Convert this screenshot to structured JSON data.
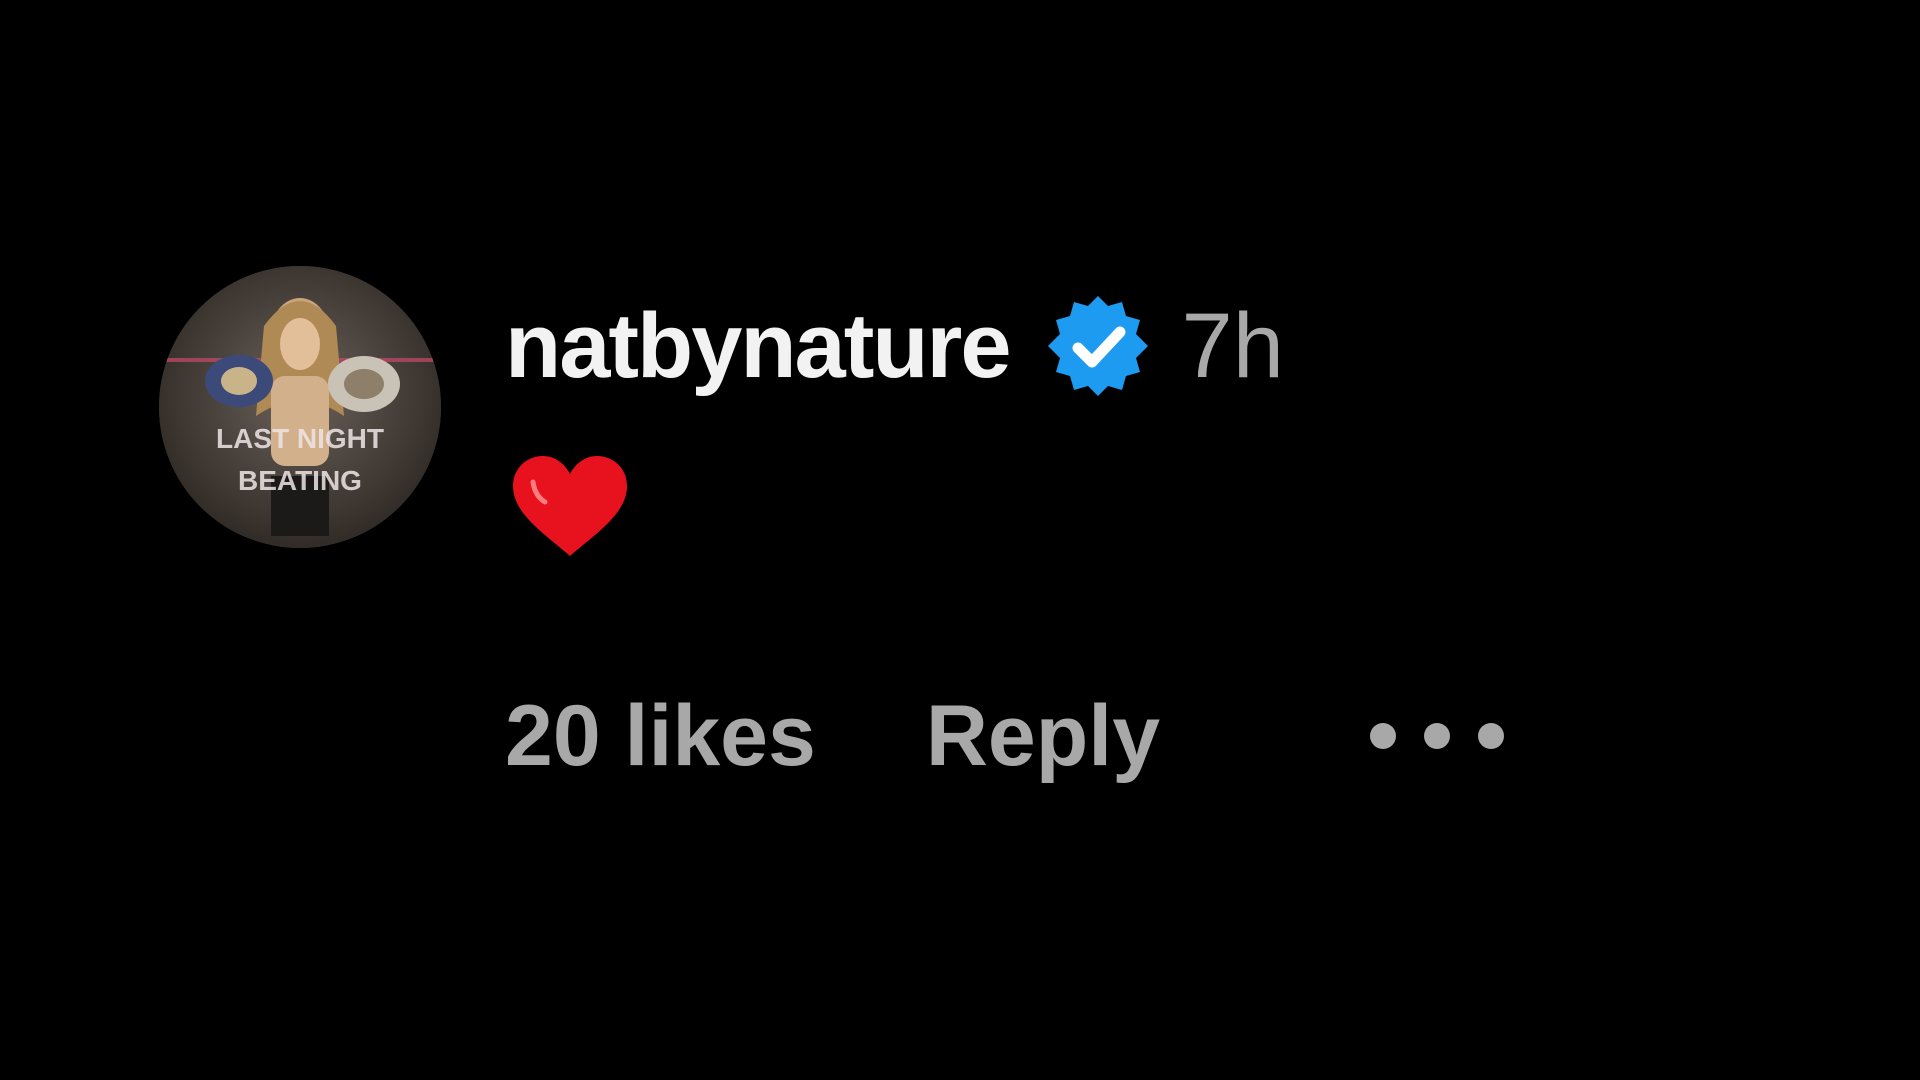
{
  "comment": {
    "username": "natbynature",
    "verified_icon": "verified-badge-icon",
    "time": "7h",
    "body_icon": "red-heart-emoji",
    "likes": "20 likes",
    "reply": "Reply",
    "more_icon": "more-options-icon",
    "avatar": {
      "text_line1": "LAST NIGHT",
      "text_line2": "BEATING"
    }
  },
  "colors": {
    "background": "#000000",
    "username": "#f2f2f2",
    "secondary": "#a8a8a8",
    "verified": "#1d9bf0",
    "heart": "#e8121f"
  }
}
